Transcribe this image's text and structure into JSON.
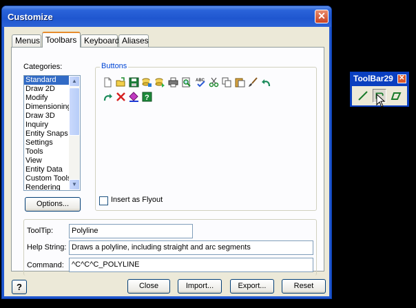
{
  "dialog": {
    "title": "Customize",
    "close_glyph": "✕"
  },
  "tabs": [
    {
      "label": "Menus",
      "active": false
    },
    {
      "label": "Toolbars",
      "active": true
    },
    {
      "label": "Keyboard",
      "active": false
    },
    {
      "label": "Aliases",
      "active": false
    }
  ],
  "categories": {
    "label": "Categories:",
    "items": [
      "Standard",
      "Draw 2D",
      "Modify",
      "Dimensioning",
      "Draw 3D",
      "Inquiry",
      "Entity Snaps",
      "Settings",
      "Tools",
      "View",
      "Entity Data",
      "Custom Tools",
      "Rendering"
    ],
    "selected": "Standard"
  },
  "buttons_group": {
    "label": "Buttons",
    "icons": [
      "new-document-icon",
      "open-folder-icon",
      "save-icon",
      "cut-paste-db-icon",
      "db-icon",
      "print-icon",
      "print-preview-icon",
      "spelling-icon",
      "scissors-icon",
      "copy-icon",
      "paste-icon",
      "brush-icon",
      "undo-icon",
      "redo-icon",
      "cancel-icon",
      "select-entity-icon",
      "help-icon"
    ]
  },
  "insert_flyout": {
    "label": "Insert as Flyout",
    "checked": false
  },
  "options_button": "Options...",
  "tooltip": {
    "label": "ToolTip:",
    "value": "Polyline"
  },
  "help_string": {
    "label": "Help String:",
    "value": "Draws a polyline, including straight and arc segments"
  },
  "command": {
    "label": "Command:",
    "value": "^C^C^C_POLYLINE"
  },
  "footer": {
    "help_glyph": "?",
    "close": "Close",
    "import": "Import...",
    "export": "Export...",
    "reset": "Reset"
  },
  "floating_toolbar": {
    "title": "ToolBar29",
    "close_glyph": "✕",
    "buttons": [
      "line-icon",
      "polyline-icon",
      "polygon-icon"
    ]
  },
  "colors": {
    "title_blue": "#1f56cf",
    "selection": "#316ac5",
    "group_label": "#0046d5"
  }
}
